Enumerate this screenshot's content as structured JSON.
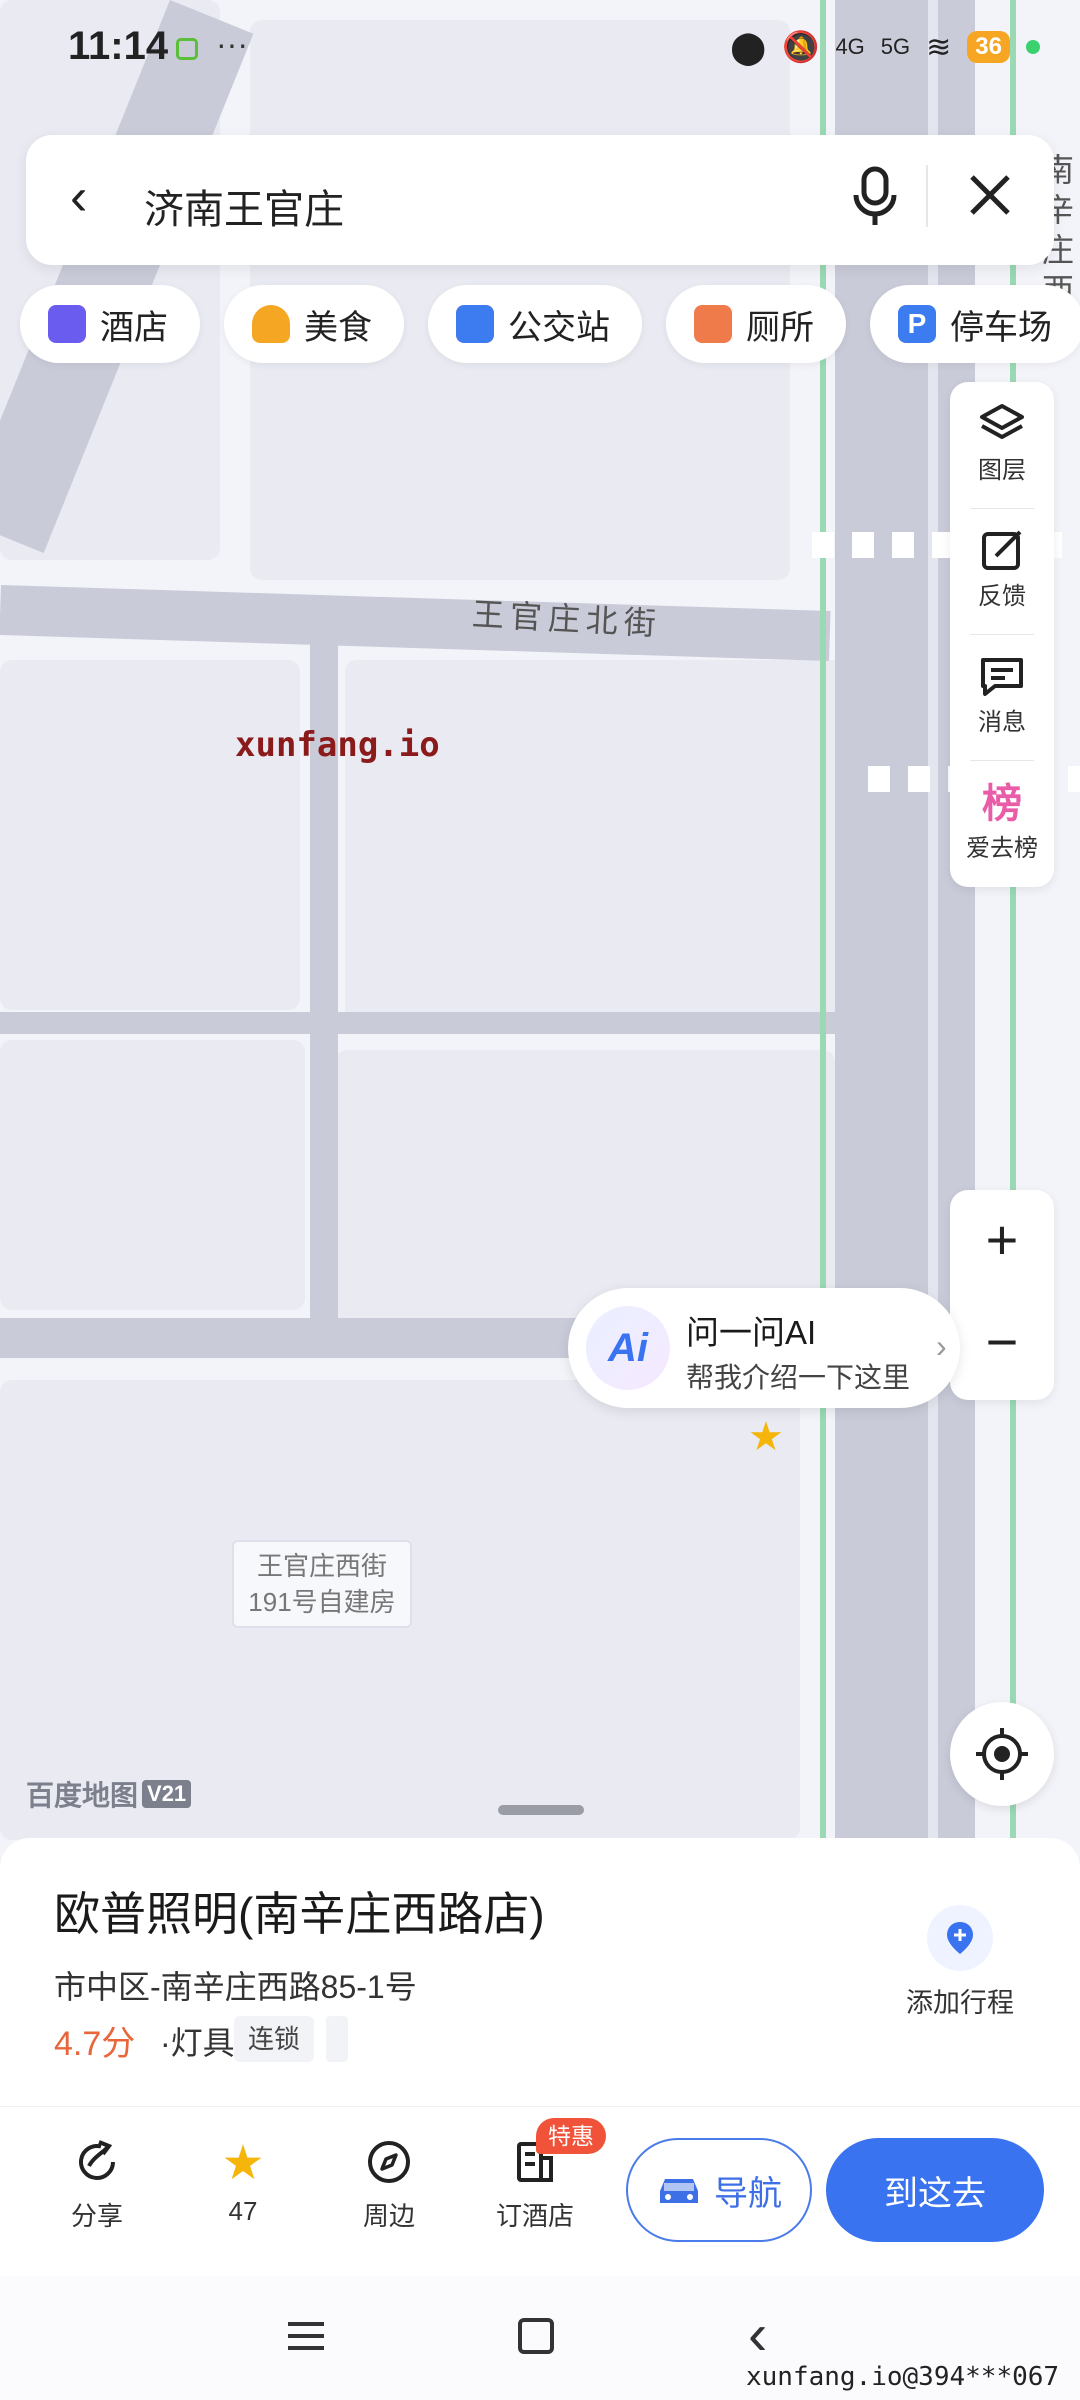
{
  "status_bar": {
    "time": "11:14",
    "network_1": "4G",
    "network_2": "5G",
    "battery": "36"
  },
  "search": {
    "query": "济南王官庄"
  },
  "categories": [
    {
      "label": "酒店",
      "icon": "hotel-icon",
      "color": "#6b5cf0"
    },
    {
      "label": "美食",
      "icon": "food-icon",
      "color": "#f5a623"
    },
    {
      "label": "公交站",
      "icon": "bus-stop-icon",
      "color": "#3d7cf0"
    },
    {
      "label": "厕所",
      "icon": "toilet-icon",
      "color": "#f07b4a"
    },
    {
      "label": "停车场",
      "icon": "parking-icon",
      "color": "#3d7cf0"
    }
  ],
  "map": {
    "road_labels": {
      "north_street": "王官庄北街",
      "east_road": "南辛庄西路"
    },
    "building_label": "王官庄西街\n191号自建房",
    "brand": "百度地图",
    "version": "V21",
    "watermark_top": "xunfang.io",
    "watermark_bottom": "xunfang.io@394***067"
  },
  "side_tools": [
    {
      "label": "图层",
      "icon": "layers-icon"
    },
    {
      "label": "反馈",
      "icon": "feedback-icon"
    },
    {
      "label": "消息",
      "icon": "message-icon"
    },
    {
      "label": "爱去榜",
      "icon": "ranking-icon",
      "glyph": "榜"
    }
  ],
  "zoom": {
    "in": "+",
    "out": "−"
  },
  "ai_bubble": {
    "title": "问一问AI",
    "subtitle": "帮我介绍一下这里",
    "icon_text": "Ai"
  },
  "poi": {
    "name": "欧普照明(南辛庄西路店)",
    "address": "市中区-南辛庄西路85-1号",
    "rating": "4.7分",
    "category": "·灯具",
    "tag": "连锁",
    "add_trip": "添加行程"
  },
  "actions": [
    {
      "label": "分享",
      "icon": "share-icon"
    },
    {
      "label": "47",
      "icon": "star-icon"
    },
    {
      "label": "周边",
      "icon": "compass-icon"
    },
    {
      "label": "订酒店",
      "icon": "hotel-booking-icon",
      "badge": "特惠"
    }
  ],
  "nav_button": "导航",
  "go_button": "到这去",
  "colors": {
    "accent": "#3a73f0",
    "rating": "#e8663a",
    "road": "#c9cbd9",
    "green_edge": "#9ad9b4"
  }
}
